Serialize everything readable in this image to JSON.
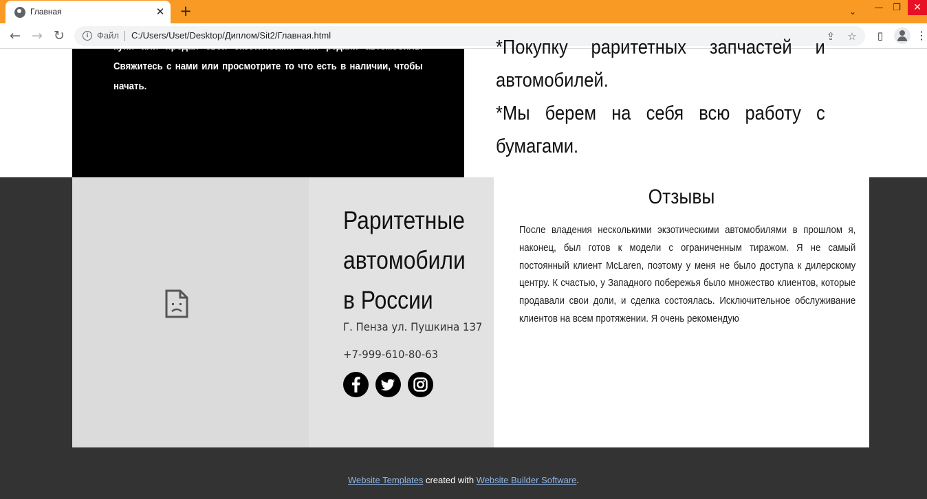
{
  "browser": {
    "tab_title": "Главная",
    "tab_close": "✕",
    "new_tab": "+",
    "file_label": "Файл",
    "url": "C:/Users/Uset/Desktop/Диплом/Sit2/Главная.html",
    "window_controls": {
      "minimize": "—",
      "restore": "❐",
      "close": "✕",
      "tabs_dropdown": "⌄"
    }
  },
  "upper": {
    "black_text": "купи или продай свой экзотический или редкий автомобиль. Свяжитесь с нами или просмотрите то что есть в наличии, чтобы начать.",
    "right_text": "*Покупку раритетных запчастей и автомобилей.",
    "right_text_2": "*Мы берем на себя всю работу с бумагами."
  },
  "company": {
    "title": "Раритетные автомобили в России",
    "address": "Г. Пенза ул. Пушкина 137",
    "phone": "+7-999-610-80-63",
    "social_icons": [
      "facebook-icon",
      "twitter-icon",
      "instagram-icon"
    ]
  },
  "reviews": {
    "title": "Отзывы",
    "text": "После владения несколькими экзотическими автомобилями в прошлом я, наконец, был готов к модели с ограниченным тиражом. Я не самый постоянный клиент McLaren, поэтому у меня не было доступа к дилерскому центру. К счастью, у Западного побережья было множество клиентов, которые продавали свои доли, и сделка состоялась. Исключительное обслуживание клиентов на всем протяжении. Я очень рекомендую"
  },
  "credits": {
    "link1": "Website Templates",
    "middle": " created with ",
    "link2": "Website Builder Software",
    "end": "."
  },
  "colors": {
    "tab_bar": "#f99a24",
    "footer_bg": "#333333",
    "link": "#8fb6e8"
  }
}
